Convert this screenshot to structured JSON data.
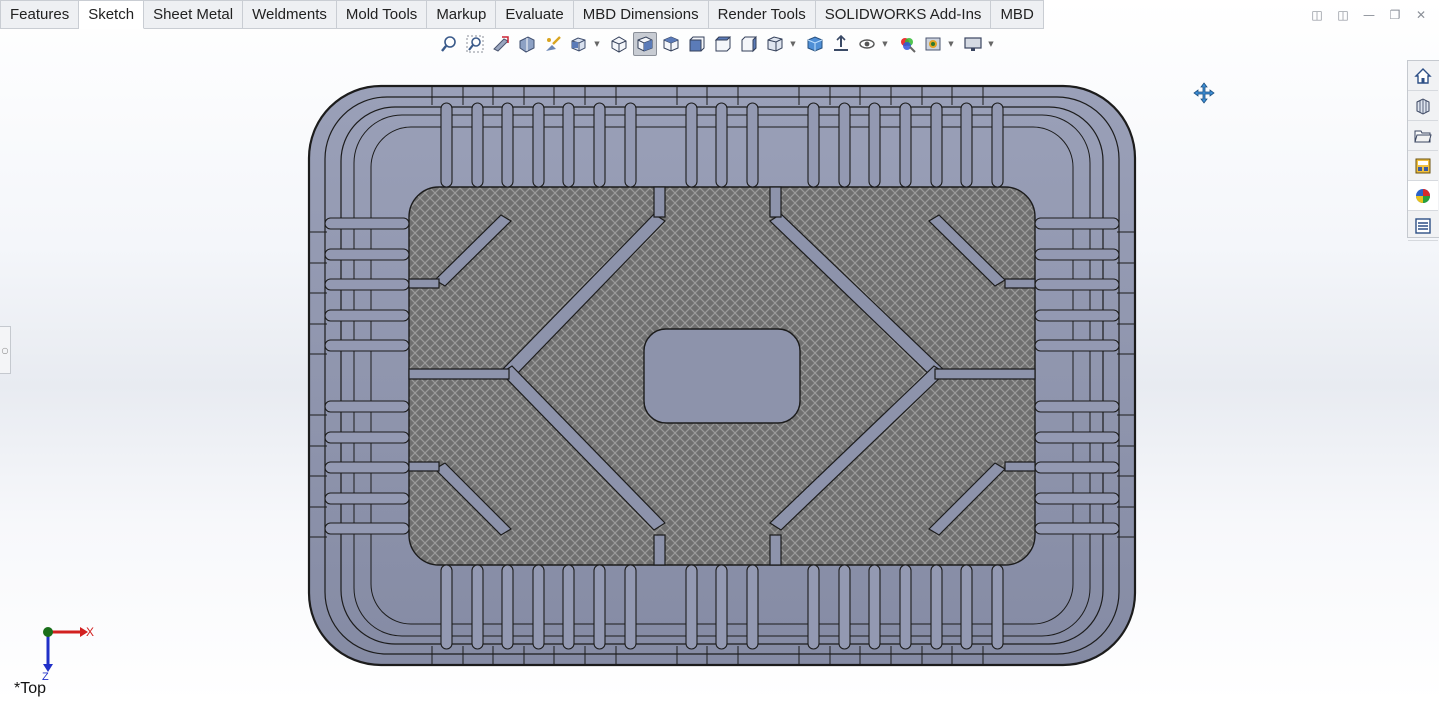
{
  "command_manager": {
    "tabs": [
      {
        "label": "Features",
        "active": false
      },
      {
        "label": "Sketch",
        "active": true
      },
      {
        "label": "Sheet Metal",
        "active": false
      },
      {
        "label": "Weldments",
        "active": false
      },
      {
        "label": "Mold Tools",
        "active": false
      },
      {
        "label": "Markup",
        "active": false
      },
      {
        "label": "Evaluate",
        "active": false
      },
      {
        "label": "MBD Dimensions",
        "active": false
      },
      {
        "label": "Render Tools",
        "active": false
      },
      {
        "label": "SOLIDWORKS Add-Ins",
        "active": false
      },
      {
        "label": "MBD",
        "active": false
      }
    ]
  },
  "heads_up_toolbar": {
    "icons": [
      "zoom-to-fit-icon",
      "zoom-to-area-icon",
      "previous-view-icon",
      "section-view-icon",
      "dynamic-annotation-icon",
      "view-orientation-icon",
      "isometric-view-icon",
      "trimetric-view-icon",
      "dimetric-view-icon",
      "front-view-icon",
      "top-view-icon",
      "right-view-icon",
      "display-style-icon",
      "shaded-icon",
      "hide-show-items-icon",
      "edit-appearance-icon",
      "apply-scene-icon",
      "view-settings-icon"
    ],
    "selected": "trimetric-view-icon"
  },
  "task_pane": {
    "items": [
      "solidworks-resources-icon",
      "design-library-icon",
      "file-explorer-icon",
      "view-palette-icon",
      "appearances-icon",
      "custom-properties-icon"
    ],
    "active": "appearances-icon"
  },
  "viewport": {
    "view_name": "*Top",
    "triad": {
      "x_label": "X",
      "z_label": "Z"
    }
  },
  "colors": {
    "model_body": "#8d93ab",
    "model_edge": "#1c1c1c",
    "texture_bg": "#6f6f6f",
    "triad_x": "#d22020",
    "triad_z": "#2030c8",
    "triad_origin": "#1a6e1a"
  }
}
